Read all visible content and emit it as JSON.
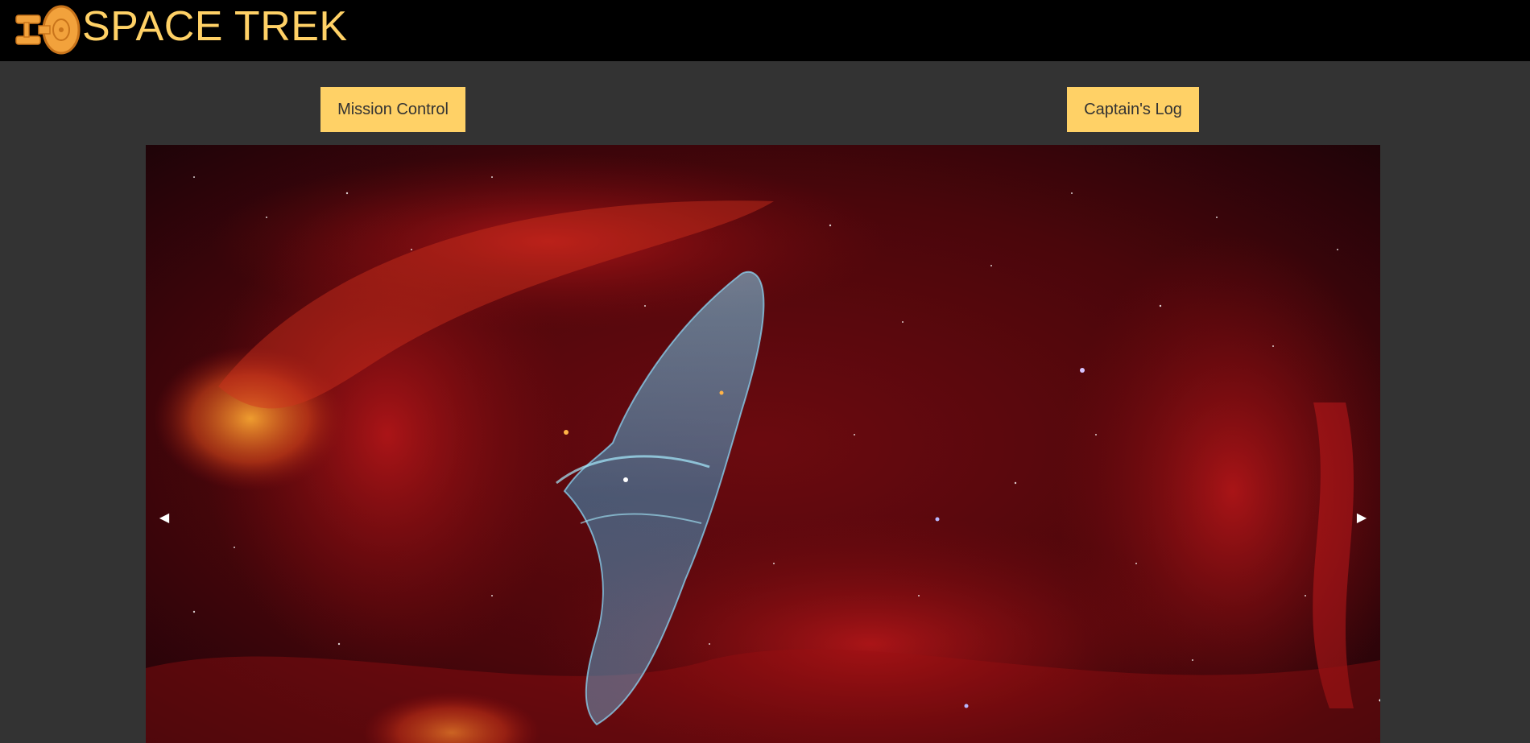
{
  "header": {
    "title": "SPACE TREK",
    "logo_icon": "starship-logo-icon",
    "brand_color": "#ffd166",
    "background": "#000000"
  },
  "nav": {
    "mission_control_label": "Mission Control",
    "captains_log_label": "Captain's Log"
  },
  "carousel": {
    "image_subject": "nebula-image",
    "prev_icon": "◀",
    "next_icon": "▶"
  },
  "colors": {
    "page_background": "#333333",
    "button_background": "#ffd166",
    "button_text": "#333333"
  }
}
